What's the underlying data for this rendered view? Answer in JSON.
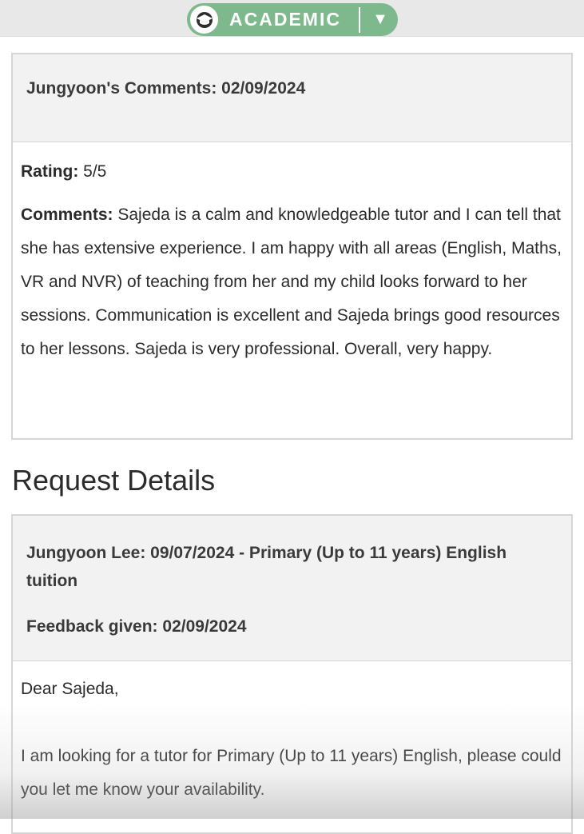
{
  "header": {
    "badge_label": "ACADEMIC",
    "dropdown_glyph": "▼",
    "badge_icon": "graduation-cap-icon",
    "accent_color": "#7db98d"
  },
  "comment_card": {
    "title": "Jungyoon's Comments: 02/09/2024",
    "rating_label": "Rating:",
    "rating_value": "5/5",
    "comments_label": "Comments:",
    "comments_text": "Sajeda is a calm and knowledgeable tutor and I can tell that she has extensive experience. I am happy with all areas (English, Maths, VR and NVR) of teaching from her and my child looks forward to her sessions. Communication is excellent and Sajeda brings good resources to her lessons. Sajeda is very professional. Overall, very happy."
  },
  "request_section": {
    "title": "Request Details",
    "request_line": "Jungyoon Lee: 09/07/2024 - Primary (Up to 11 years) English tuition",
    "feedback_line": "Feedback given: 02/09/2024",
    "greeting": "Dear Sajeda,",
    "message": "I am looking for a tutor for Primary (Up to 11 years) English, please could you let me know your availability."
  }
}
